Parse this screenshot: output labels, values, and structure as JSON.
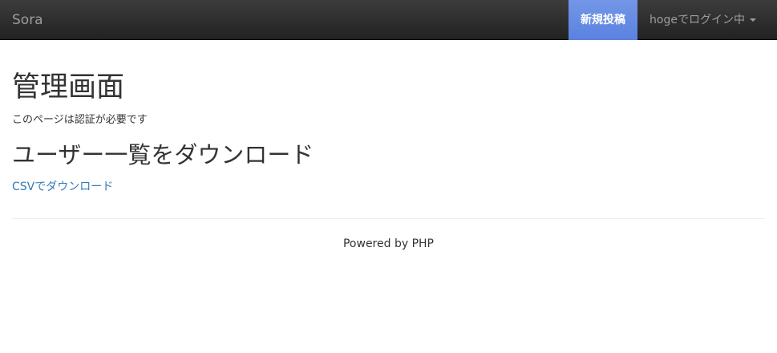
{
  "navbar": {
    "brand": "Sora",
    "new_post_label": "新規投稿",
    "user_menu_label": "hogeでログイン中"
  },
  "main": {
    "title": "管理画面",
    "auth_note": "このページは認証が必要です",
    "section_title": "ユーザー一覧をダウンロード",
    "csv_link": "CSVでダウンロード"
  },
  "footer": {
    "text": "Powered by PHP"
  },
  "colors": {
    "navbar_bg": "#222222",
    "active_nav_bg": "#6a8fe4",
    "link": "#337ab7",
    "text": "#333333",
    "nav_text": "#9d9d9d"
  },
  "icons": {
    "user_menu_caret": "caret-down-icon"
  }
}
